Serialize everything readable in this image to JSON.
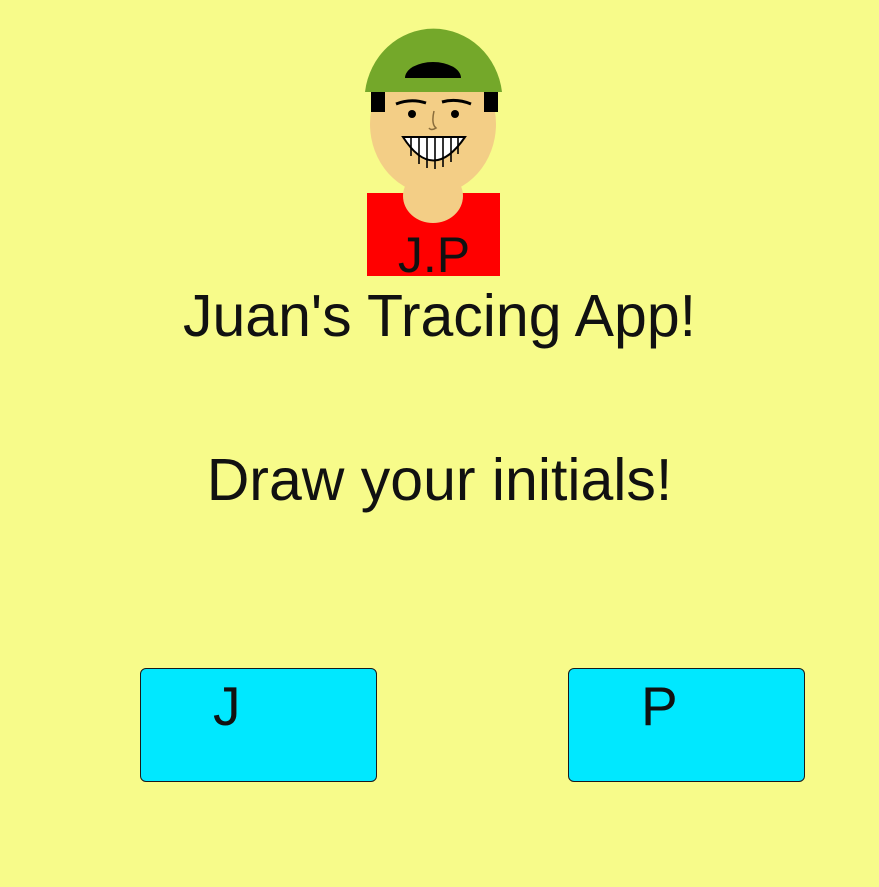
{
  "app": {
    "title": "Juan's Tracing App!",
    "instruction": "Draw your initials!"
  },
  "avatar": {
    "icon": "cartoon-boy-with-cap-avatar",
    "shirt_text": "J.P",
    "colors": {
      "cap": "#74a82a",
      "skin": "#f3ce86",
      "shirt": "#ff0000",
      "hair": "#000000"
    }
  },
  "buttons": [
    {
      "label": "J"
    },
    {
      "label": "P"
    }
  ],
  "colors": {
    "background": "#f7fb8a",
    "button": "#00e8ff",
    "text": "#111111"
  }
}
